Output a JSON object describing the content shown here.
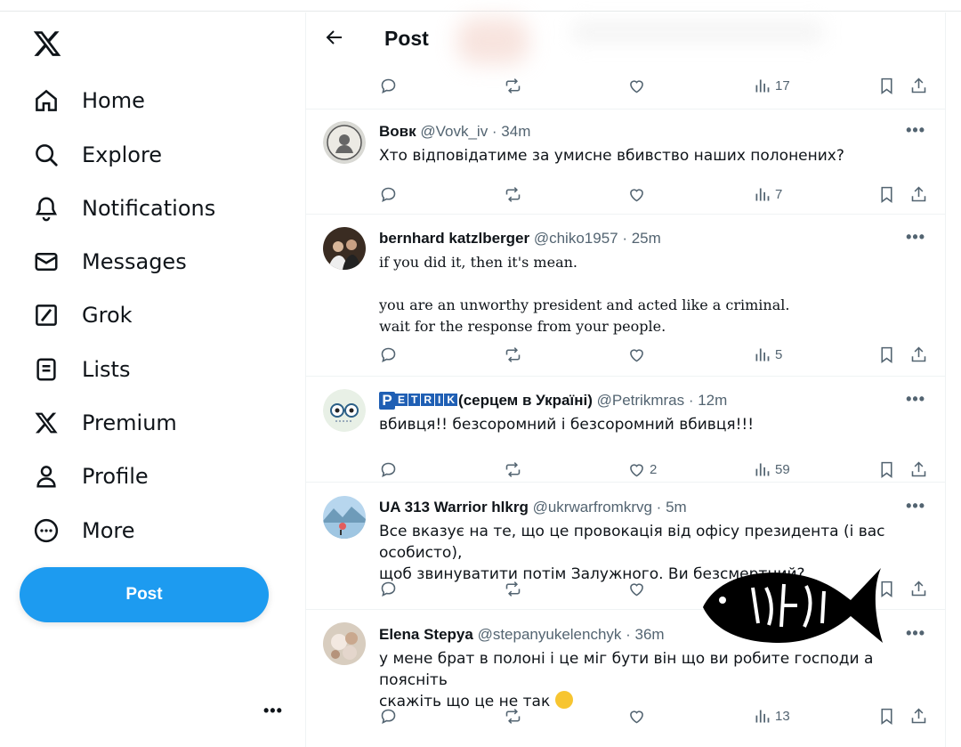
{
  "sidebar": {
    "logo": "x-logo-icon",
    "items": [
      {
        "label": "Home",
        "icon": "home-icon"
      },
      {
        "label": "Explore",
        "icon": "search-icon"
      },
      {
        "label": "Notifications",
        "icon": "bell-icon"
      },
      {
        "label": "Messages",
        "icon": "envelope-icon"
      },
      {
        "label": "Grok",
        "icon": "grok-icon"
      },
      {
        "label": "Lists",
        "icon": "list-icon"
      },
      {
        "label": "Premium",
        "icon": "x-logo-icon"
      },
      {
        "label": "Profile",
        "icon": "person-icon"
      },
      {
        "label": "More",
        "icon": "more-circle-icon"
      }
    ],
    "post_button": "Post",
    "more_dots": "•••"
  },
  "header": {
    "title": "Post"
  },
  "top_actions": {
    "views": "17"
  },
  "tweets": [
    {
      "name": "Вовк",
      "handle": "@Vovk_iv · 34m",
      "text": [
        "Хто відповідатиме за умисне вбивство наших полонених?"
      ],
      "likes": "",
      "views": "7"
    },
    {
      "name": "bernhard katzlberger",
      "handle": "@chiko1957 · 25m",
      "text": [
        "if you did it, then it's mean.",
        "",
        "you are an unworthy president and acted like a criminal.",
        "wait for the response from your people."
      ],
      "likes": "",
      "views": "5"
    },
    {
      "name_badge": "P",
      "name_letters": [
        "E",
        "T",
        "R",
        "I",
        "K"
      ],
      "name": "(серцем в Україні)",
      "handle": "@Petrikmras · 12m",
      "text": [
        "вбивця!! безсоромний і безсоромний вбивця!!!"
      ],
      "likes": "2",
      "views": "59"
    },
    {
      "name": "UA 313 Warrior hlkrg",
      "handle": "@ukrwarfromkrvg · 5m",
      "text": [
        "Все вказує на те, що це провокація від офісу президента (і вас особисто),",
        "щоб звинуватити потім Залужного. Ви безсмертний?"
      ],
      "likes": "",
      "views": ""
    },
    {
      "name": "Elena Stepya",
      "handle": "@stepanyukelenchyk · 36m",
      "text": [
        "у мене брат в полоні і це міг бути він що ви робите господи а поясніть",
        "скажіть що це не так"
      ],
      "likes": "",
      "views": "13"
    }
  ],
  "more_dots": "•••",
  "watermark": {
    "text": "VOBLA",
    "color": "#000000"
  },
  "colors": {
    "accent": "#1d9bf0",
    "muted": "#536471",
    "text": "#0f1419"
  }
}
